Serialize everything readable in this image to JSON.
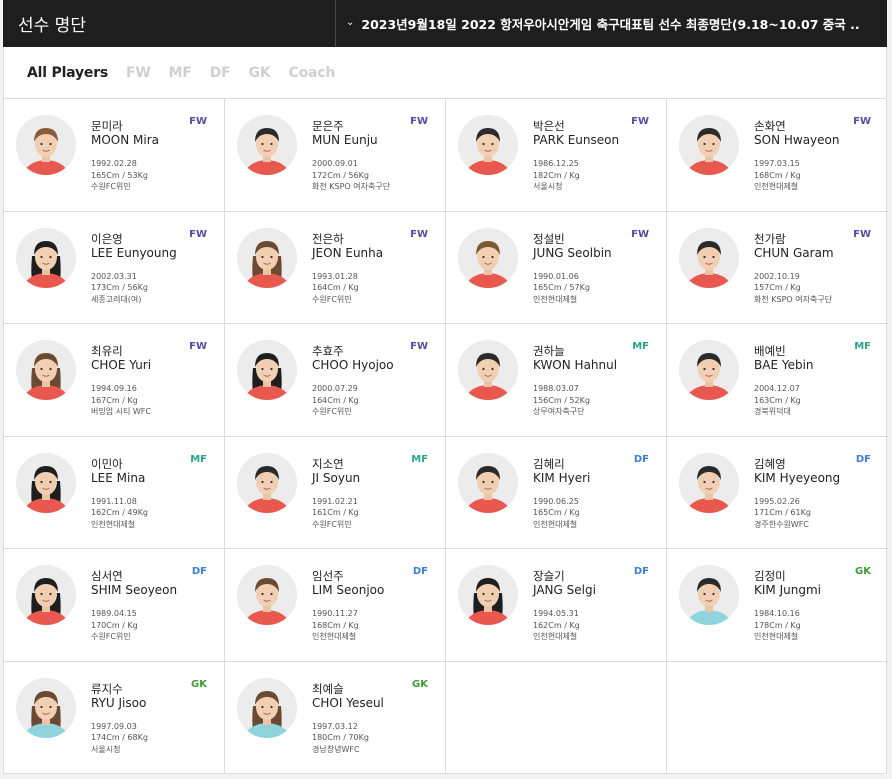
{
  "header": {
    "title": "선수 명단",
    "selected_roster": "2023년9월18일 2022 항저우아시안게임 축구대표팀 선수 최종명단(9.18~10.07 중국 .."
  },
  "tabs": [
    {
      "label": "All Players",
      "active": true
    },
    {
      "label": "FW",
      "active": false
    },
    {
      "label": "MF",
      "active": false
    },
    {
      "label": "DF",
      "active": false
    },
    {
      "label": "GK",
      "active": false
    },
    {
      "label": "Coach",
      "active": false
    }
  ],
  "colors": {
    "fw": "#5a4aa8",
    "mf": "#2ba38a",
    "df": "#3d7fd0",
    "gk": "#3e9a36",
    "field_jersey": "#e8584f",
    "gk_jersey": "#8fd3dc"
  },
  "players": [
    {
      "name_kr": "문미라",
      "name_en": "MOON Mira",
      "pos": "FW",
      "birth": "1992.02.28",
      "body": "165Cm / 53Kg",
      "club": "수원FC위민",
      "hair": "#8a5a3a",
      "hair_style": "short"
    },
    {
      "name_kr": "문은주",
      "name_en": "MUN Eunju",
      "pos": "FW",
      "birth": "2000.09.01",
      "body": "172Cm / 56Kg",
      "club": "화천 KSPO 여자축구단",
      "hair": "#2a2a2a",
      "hair_style": "short"
    },
    {
      "name_kr": "박은선",
      "name_en": "PARK Eunseon",
      "pos": "FW",
      "birth": "1986.12.25",
      "body": "182Cm / Kg",
      "club": "서울시청",
      "hair": "#2a2a2a",
      "hair_style": "short"
    },
    {
      "name_kr": "손화연",
      "name_en": "SON Hwayeon",
      "pos": "FW",
      "birth": "1997.03.15",
      "body": "168Cm / Kg",
      "club": "인천현대제철",
      "hair": "#2a2a2a",
      "hair_style": "short"
    },
    {
      "name_kr": "이은영",
      "name_en": "LEE Eunyoung",
      "pos": "FW",
      "birth": "2002.03.31",
      "body": "173Cm / 56Kg",
      "club": "세종고려대(여)",
      "hair": "#1e1e1e",
      "hair_style": "long"
    },
    {
      "name_kr": "전은하",
      "name_en": "JEON Eunha",
      "pos": "FW",
      "birth": "1993.01.28",
      "body": "164Cm / Kg",
      "club": "수원FC위민",
      "hair": "#6a4a32",
      "hair_style": "long"
    },
    {
      "name_kr": "정설빈",
      "name_en": "JUNG Seolbin",
      "pos": "FW",
      "birth": "1990.01.06",
      "body": "165Cm / 57Kg",
      "club": "인천현대제철",
      "hair": "#7a5838",
      "hair_style": "short"
    },
    {
      "name_kr": "천가람",
      "name_en": "CHUN Garam",
      "pos": "FW",
      "birth": "2002.10.19",
      "body": "157Cm / Kg",
      "club": "화천 KSPO 여자축구단",
      "hair": "#2a2a2a",
      "hair_style": "short"
    },
    {
      "name_kr": "최유리",
      "name_en": "CHOE Yuri",
      "pos": "FW",
      "birth": "1994.09.16",
      "body": "167Cm / Kg",
      "club": "버밍엄 시티 WFC",
      "hair": "#6a4a32",
      "hair_style": "long"
    },
    {
      "name_kr": "추효주",
      "name_en": "CHOO Hyojoo",
      "pos": "FW",
      "birth": "2000.07.29",
      "body": "164Cm / Kg",
      "club": "수원FC위민",
      "hair": "#1e1e1e",
      "hair_style": "long"
    },
    {
      "name_kr": "권하늘",
      "name_en": "KWON Hahnul",
      "pos": "MF",
      "birth": "1988.03.07",
      "body": "156Cm / 52Kg",
      "club": "상무여자축구단",
      "hair": "#2a2a2a",
      "hair_style": "short"
    },
    {
      "name_kr": "배예빈",
      "name_en": "BAE Yebin",
      "pos": "MF",
      "birth": "2004.12.07",
      "body": "163Cm / Kg",
      "club": "경북위덕대",
      "hair": "#2a2a2a",
      "hair_style": "short"
    },
    {
      "name_kr": "이민아",
      "name_en": "LEE Mina",
      "pos": "MF",
      "birth": "1991.11.08",
      "body": "162Cm / 49Kg",
      "club": "인천현대제철",
      "hair": "#1e1e1e",
      "hair_style": "long"
    },
    {
      "name_kr": "지소연",
      "name_en": "JI Soyun",
      "pos": "MF",
      "birth": "1991.02.21",
      "body": "161Cm / Kg",
      "club": "수원FC위민",
      "hair": "#2a2a2a",
      "hair_style": "short"
    },
    {
      "name_kr": "김혜리",
      "name_en": "KIM Hyeri",
      "pos": "DF",
      "birth": "1990.06.25",
      "body": "165Cm / Kg",
      "club": "인천현대제철",
      "hair": "#2a2a2a",
      "hair_style": "short"
    },
    {
      "name_kr": "김혜영",
      "name_en": "KIM Hyeyeong",
      "pos": "DF",
      "birth": "1995.02.26",
      "body": "171Cm / 61Kg",
      "club": "경주한수원WFC",
      "hair": "#2a2a2a",
      "hair_style": "short"
    },
    {
      "name_kr": "심서연",
      "name_en": "SHIM Seoyeon",
      "pos": "DF",
      "birth": "1989.04.15",
      "body": "170Cm / Kg",
      "club": "수원FC위민",
      "hair": "#1e1e1e",
      "hair_style": "long"
    },
    {
      "name_kr": "임선주",
      "name_en": "LIM Seonjoo",
      "pos": "DF",
      "birth": "1990.11.27",
      "body": "168Cm / Kg",
      "club": "인천현대제철",
      "hair": "#6a4a32",
      "hair_style": "short"
    },
    {
      "name_kr": "장슬기",
      "name_en": "JANG Selgi",
      "pos": "DF",
      "birth": "1994.05.31",
      "body": "162Cm / Kg",
      "club": "인천현대제철",
      "hair": "#1e1e1e",
      "hair_style": "long"
    },
    {
      "name_kr": "김정미",
      "name_en": "KIM Jungmi",
      "pos": "GK",
      "birth": "1984.10.16",
      "body": "178Cm / Kg",
      "club": "인천현대제철",
      "hair": "#2a2a2a",
      "hair_style": "short"
    },
    {
      "name_kr": "류지수",
      "name_en": "RYU Jisoo",
      "pos": "GK",
      "birth": "1997.09.03",
      "body": "174Cm / 68Kg",
      "club": "서울시청",
      "hair": "#6a4a32",
      "hair_style": "long"
    },
    {
      "name_kr": "최예슬",
      "name_en": "CHOI Yeseul",
      "pos": "GK",
      "birth": "1997.03.12",
      "body": "180Cm / 70Kg",
      "club": "경남창녕WFC",
      "hair": "#6a4a32",
      "hair_style": "long"
    }
  ]
}
